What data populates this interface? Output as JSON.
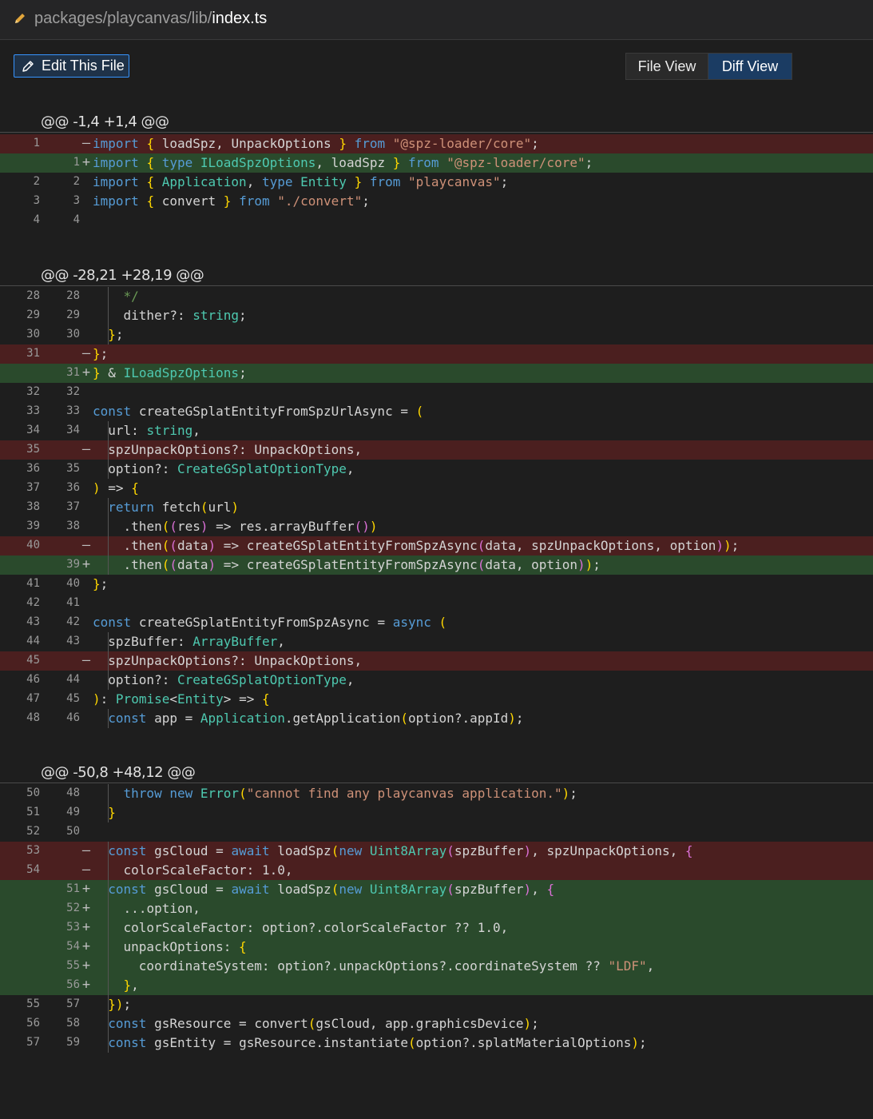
{
  "header": {
    "path_dir": "packages/playcanvas/lib/",
    "file_name": "index.ts"
  },
  "toolbar": {
    "edit_label": "Edit This File",
    "file_view_label": "File View",
    "diff_view_label": "Diff View",
    "active_view": "Diff View"
  },
  "hunks": [
    {
      "header": "@@ -1,4 +1,4 @@"
    },
    {
      "header": "@@ -28,21 +28,19 @@"
    },
    {
      "header": "@@ -50,8 +48,12 @@"
    }
  ],
  "colors": {
    "deleted_line": "#4b1f1f",
    "added_line": "#2a4a2c",
    "keyword": "#569cd6",
    "type": "#4ec9b0",
    "string": "#ce9178",
    "active_tab": "#1b3c63"
  },
  "lines": [
    {
      "old": "1",
      "new": "",
      "type": "del",
      "text": "import { loadSpz, UnpackOptions } from \"@spz-loader/core\";"
    },
    {
      "old": "",
      "new": "1",
      "type": "add",
      "text": "import { type ILoadSpzOptions, loadSpz } from \"@spz-loader/core\";"
    },
    {
      "old": "2",
      "new": "2",
      "type": "ctx",
      "text": "import { Application, type Entity } from \"playcanvas\";"
    },
    {
      "old": "3",
      "new": "3",
      "type": "ctx",
      "text": "import { convert } from \"./convert\";"
    },
    {
      "old": "4",
      "new": "4",
      "type": "ctx",
      "text": ""
    },
    {
      "old": "28",
      "new": "28",
      "type": "ctx",
      "text": "    */"
    },
    {
      "old": "29",
      "new": "29",
      "type": "ctx",
      "text": "    dither?: string;"
    },
    {
      "old": "30",
      "new": "30",
      "type": "ctx",
      "text": "  };"
    },
    {
      "old": "31",
      "new": "",
      "type": "del",
      "text": "};"
    },
    {
      "old": "",
      "new": "31",
      "type": "add",
      "text": "} & ILoadSpzOptions;"
    },
    {
      "old": "32",
      "new": "32",
      "type": "ctx",
      "text": ""
    },
    {
      "old": "33",
      "new": "33",
      "type": "ctx",
      "text": "const createGSplatEntityFromSpzUrlAsync = ("
    },
    {
      "old": "34",
      "new": "34",
      "type": "ctx",
      "text": "  url: string,"
    },
    {
      "old": "35",
      "new": "",
      "type": "del",
      "text": "  spzUnpackOptions?: UnpackOptions,"
    },
    {
      "old": "36",
      "new": "35",
      "type": "ctx",
      "text": "  option?: CreateGSplatOptionType,"
    },
    {
      "old": "37",
      "new": "36",
      "type": "ctx",
      "text": ") => {"
    },
    {
      "old": "38",
      "new": "37",
      "type": "ctx",
      "text": "  return fetch(url)"
    },
    {
      "old": "39",
      "new": "38",
      "type": "ctx",
      "text": "    .then((res) => res.arrayBuffer())"
    },
    {
      "old": "40",
      "new": "",
      "type": "del",
      "text": "    .then((data) => createGSplatEntityFromSpzAsync(data, spzUnpackOptions, option));"
    },
    {
      "old": "",
      "new": "39",
      "type": "add",
      "text": "    .then((data) => createGSplatEntityFromSpzAsync(data, option));"
    },
    {
      "old": "41",
      "new": "40",
      "type": "ctx",
      "text": "};"
    },
    {
      "old": "42",
      "new": "41",
      "type": "ctx",
      "text": ""
    },
    {
      "old": "43",
      "new": "42",
      "type": "ctx",
      "text": "const createGSplatEntityFromSpzAsync = async ("
    },
    {
      "old": "44",
      "new": "43",
      "type": "ctx",
      "text": "  spzBuffer: ArrayBuffer,"
    },
    {
      "old": "45",
      "new": "",
      "type": "del",
      "text": "  spzUnpackOptions?: UnpackOptions,"
    },
    {
      "old": "46",
      "new": "44",
      "type": "ctx",
      "text": "  option?: CreateGSplatOptionType,"
    },
    {
      "old": "47",
      "new": "45",
      "type": "ctx",
      "text": "): Promise<Entity> => {"
    },
    {
      "old": "48",
      "new": "46",
      "type": "ctx",
      "text": "  const app = Application.getApplication(option?.appId);"
    },
    {
      "old": "50",
      "new": "48",
      "type": "ctx",
      "text": "    throw new Error(\"cannot find any playcanvas application.\");"
    },
    {
      "old": "51",
      "new": "49",
      "type": "ctx",
      "text": "  }"
    },
    {
      "old": "52",
      "new": "50",
      "type": "ctx",
      "text": ""
    },
    {
      "old": "53",
      "new": "",
      "type": "del",
      "text": "  const gsCloud = await loadSpz(new Uint8Array(spzBuffer), spzUnpackOptions, {"
    },
    {
      "old": "54",
      "new": "",
      "type": "del",
      "text": "    colorScaleFactor: 1.0,"
    },
    {
      "old": "",
      "new": "51",
      "type": "add",
      "text": "  const gsCloud = await loadSpz(new Uint8Array(spzBuffer), {"
    },
    {
      "old": "",
      "new": "52",
      "type": "add",
      "text": "    ...option,"
    },
    {
      "old": "",
      "new": "53",
      "type": "add",
      "text": "    colorScaleFactor: option?.colorScaleFactor ?? 1.0,"
    },
    {
      "old": "",
      "new": "54",
      "type": "add",
      "text": "    unpackOptions: {"
    },
    {
      "old": "",
      "new": "55",
      "type": "add",
      "text": "      coordinateSystem: option?.unpackOptions?.coordinateSystem ?? \"LDF\","
    },
    {
      "old": "",
      "new": "56",
      "type": "add",
      "text": "    },"
    },
    {
      "old": "55",
      "new": "57",
      "type": "ctx",
      "text": "  });"
    },
    {
      "old": "56",
      "new": "58",
      "type": "ctx",
      "text": "  const gsResource = convert(gsCloud, app.graphicsDevice);"
    },
    {
      "old": "57",
      "new": "59",
      "type": "ctx",
      "text": "  const gsEntity = gsResource.instantiate(option?.splatMaterialOptions);"
    }
  ]
}
